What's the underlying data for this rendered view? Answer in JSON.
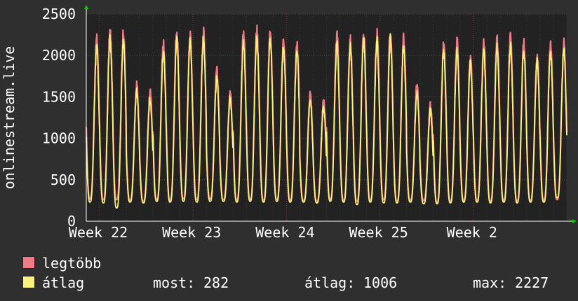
{
  "chart_data": {
    "type": "line",
    "ylabel": "onlinestream.live",
    "ylim": [
      0,
      2500
    ],
    "y_ticks": [
      "0",
      "500",
      "1000",
      "1500",
      "2000",
      "2500"
    ],
    "x_ticks": [
      "Week 22",
      "Week 23",
      "Week 24",
      "Week 25",
      "Week 2"
    ],
    "grid": true,
    "legend_placement": "bottom",
    "days": 36,
    "series": [
      {
        "name": "legtöbb",
        "color": "#f07b84",
        "daily_peak": [
          2200,
          2290,
          2260,
          1640,
          1560,
          2140,
          2270,
          2260,
          2270,
          1820,
          1580,
          2260,
          2300,
          2280,
          2200,
          2140,
          1520,
          1450,
          2230,
          2180,
          2260,
          2260,
          2290,
          2200,
          1640,
          1420,
          2120,
          2150,
          1980,
          2140,
          2180,
          2210,
          2150,
          2000,
          2140,
          2140
        ],
        "daily_trough": [
          270,
          260,
          260,
          250,
          240,
          260,
          250,
          270,
          260,
          270,
          260,
          250,
          260,
          250,
          260,
          250,
          250,
          240,
          260,
          250,
          240,
          250,
          260,
          240,
          250,
          250,
          230,
          240,
          250,
          250,
          240,
          250,
          240,
          250,
          250,
          260
        ]
      },
      {
        "name": "átlag",
        "color": "#fff27a",
        "daily_peak": [
          2100,
          2200,
          2170,
          1560,
          1470,
          2050,
          2180,
          2180,
          2190,
          1720,
          1490,
          2160,
          2200,
          2190,
          2110,
          2050,
          1440,
          1370,
          2130,
          2090,
          2170,
          2170,
          2190,
          2100,
          1560,
          1340,
          2040,
          2060,
          1900,
          2050,
          2080,
          2110,
          2060,
          1920,
          2050,
          2050
        ],
        "daily_trough": [
          230,
          220,
          160,
          230,
          220,
          240,
          230,
          240,
          230,
          240,
          240,
          230,
          240,
          230,
          240,
          230,
          230,
          220,
          240,
          230,
          200,
          230,
          220,
          220,
          230,
          210,
          210,
          220,
          230,
          230,
          220,
          230,
          220,
          230,
          230,
          282
        ]
      }
    ],
    "stats": {
      "most_label": "most:",
      "most_value": "282",
      "avg_label": "átlag:",
      "avg_value": "1006",
      "max_label": "max:",
      "max_value": "2227"
    }
  },
  "colors": {
    "background": "#2f2f2f",
    "plot_background": "#222222",
    "grid": "#4a4a4a",
    "axis_arrow": "#00cc00"
  }
}
